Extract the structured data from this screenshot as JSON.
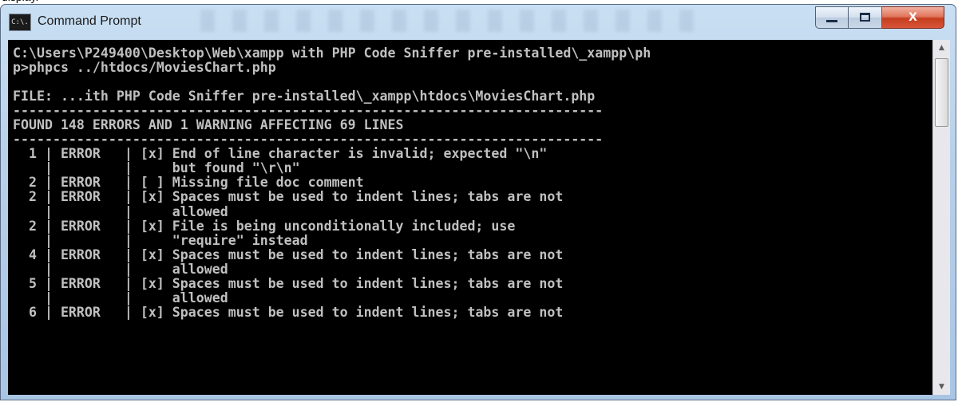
{
  "window": {
    "title": "Command Prompt",
    "icon_text": "C:\\.",
    "minimize_icon": "minimize-icon",
    "maximize_icon": "maximize-icon",
    "close_glyph": "X"
  },
  "console": {
    "background": "#000000",
    "text_color": "#c0c0c0",
    "lines": [
      "C:\\Users\\P249400\\Desktop\\Web\\xampp with PHP Code Sniffer pre-installed\\_xampp\\ph",
      "p>phpcs ../htdocs/MoviesChart.php",
      "",
      "FILE: ...ith PHP Code Sniffer pre-installed\\_xampp\\htdocs\\MoviesChart.php",
      "--------------------------------------------------------------------------",
      "FOUND 148 ERRORS AND 1 WARNING AFFECTING 69 LINES",
      "--------------------------------------------------------------------------",
      "  1 | ERROR   | [x] End of line character is invalid; expected \"\\n\"",
      "    |         |     but found \"\\r\\n\"",
      "  2 | ERROR   | [ ] Missing file doc comment",
      "  2 | ERROR   | [x] Spaces must be used to indent lines; tabs are not",
      "    |         |     allowed",
      "  2 | ERROR   | [x] File is being unconditionally included; use",
      "    |         |     \"require\" instead",
      "  4 | ERROR   | [x] Spaces must be used to indent lines; tabs are not",
      "    |         |     allowed",
      "  5 | ERROR   | [x] Spaces must be used to indent lines; tabs are not",
      "    |         |     allowed",
      "  6 | ERROR   | [x] Spaces must be used to indent lines; tabs are not"
    ]
  },
  "scrollbar": {
    "up_icon": "scroll-up-arrow-icon",
    "down_icon": "scroll-down-arrow-icon"
  }
}
